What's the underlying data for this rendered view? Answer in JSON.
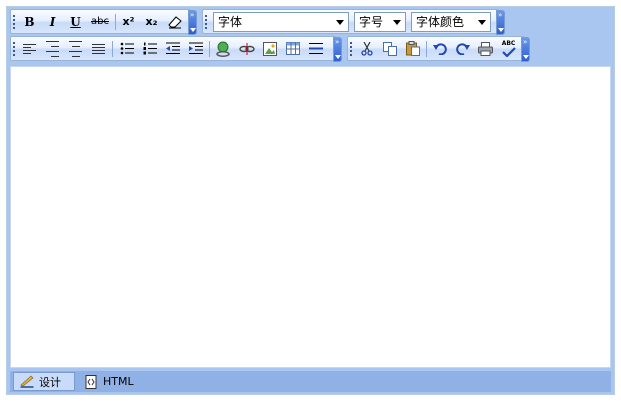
{
  "toolbar1": {
    "format_buttons": [
      {
        "icon": "bold-icon",
        "label": "B"
      },
      {
        "icon": "italic-icon",
        "label": "I"
      },
      {
        "icon": "underline-icon",
        "label": "U"
      },
      {
        "icon": "strikethrough-icon",
        "label": "abc"
      },
      {
        "icon": "superscript-icon",
        "label": "x²"
      },
      {
        "icon": "subscript-icon",
        "label": "x₂"
      },
      {
        "icon": "eraser-icon",
        "label": ""
      }
    ],
    "font_family": {
      "value": "字体"
    },
    "font_size": {
      "value": "字号"
    },
    "font_color": {
      "value": "字体颜色"
    }
  },
  "toolbar2": {
    "paragraph_buttons": [
      "align-left-icon",
      "align-right-icon",
      "align-center-icon",
      "justify-icon",
      "bulleted-list-icon",
      "numbered-list-icon",
      "outdent-icon",
      "indent-icon"
    ],
    "insert_buttons": [
      "insert-link-icon",
      "remove-link-icon",
      "insert-image-icon",
      "insert-table-icon",
      "horizontal-rule-icon"
    ],
    "edit_buttons": [
      "cut-icon",
      "copy-icon",
      "paste-icon",
      "undo-icon",
      "redo-icon",
      "print-icon",
      "spellcheck-icon"
    ],
    "spellcheck_text": "ABC"
  },
  "status_tabs": [
    {
      "label": "设计",
      "icon": "design-icon",
      "active": true
    },
    {
      "label": "HTML",
      "icon": "html-doc-icon",
      "active": false
    }
  ],
  "colors": {
    "frame": "#a8c6f0",
    "statusbar": "#8fb1e6",
    "toolbar_end": "#2e5fd0"
  }
}
